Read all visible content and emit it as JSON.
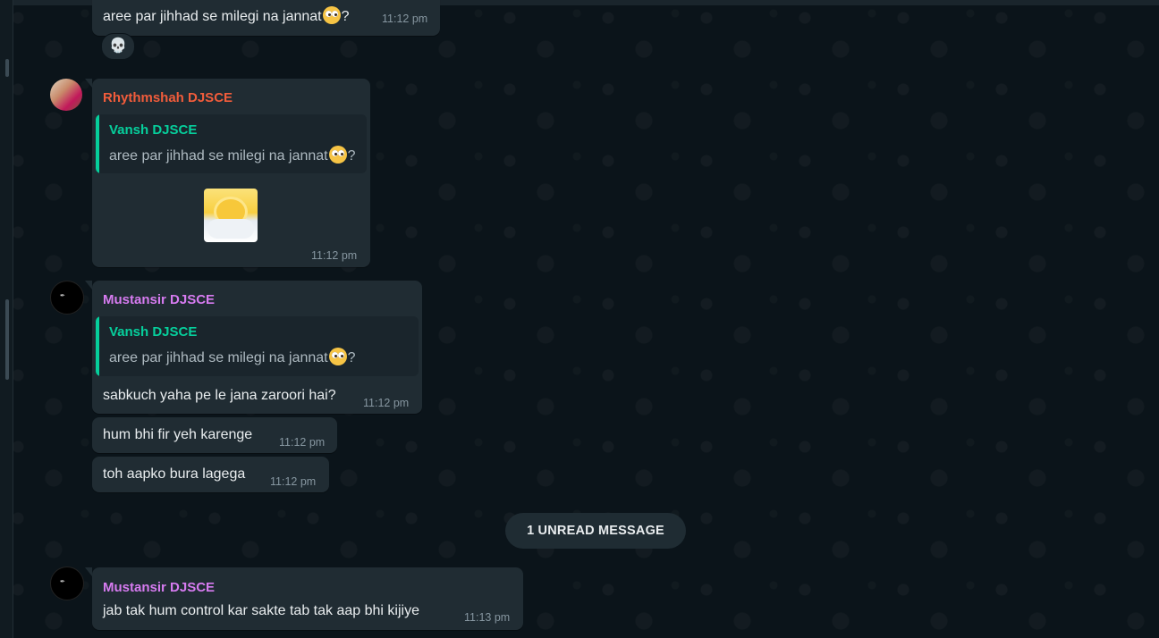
{
  "messages": {
    "top": {
      "text": "aree par jihhad se milegi na jannat",
      "suffix": "?",
      "time": "11:12 pm",
      "reaction": "💀"
    },
    "rhythm": {
      "sender": "Rhythmshah DJSCE",
      "quote_name": "Vansh DJSCE",
      "quote_text": "aree par jihhad se milegi na jannat",
      "quote_suffix": "?",
      "time": "11:12 pm"
    },
    "must1": {
      "sender": "Mustansir DJSCE",
      "quote_name": "Vansh DJSCE",
      "quote_text": "aree par jihhad se milegi na jannat",
      "quote_suffix": "?",
      "text": "sabkuch yaha pe le jana zaroori hai?",
      "time": "11:12 pm"
    },
    "must2": {
      "text": "hum bhi fir yeh karenge",
      "time": "11:12 pm"
    },
    "must3": {
      "text": "toh aapko bura lagega",
      "time": "11:12 pm"
    },
    "unread": "1 UNREAD MESSAGE",
    "must4": {
      "sender": "Mustansir DJSCE",
      "text": "jab tak hum control kar sakte tab tak aap bhi kijiye",
      "time": "11:13 pm"
    }
  },
  "colors": {
    "rhythm_name": "#f15c3b",
    "mustansir_name": "#d67bf0",
    "quote_accent": "#06cf9c"
  }
}
